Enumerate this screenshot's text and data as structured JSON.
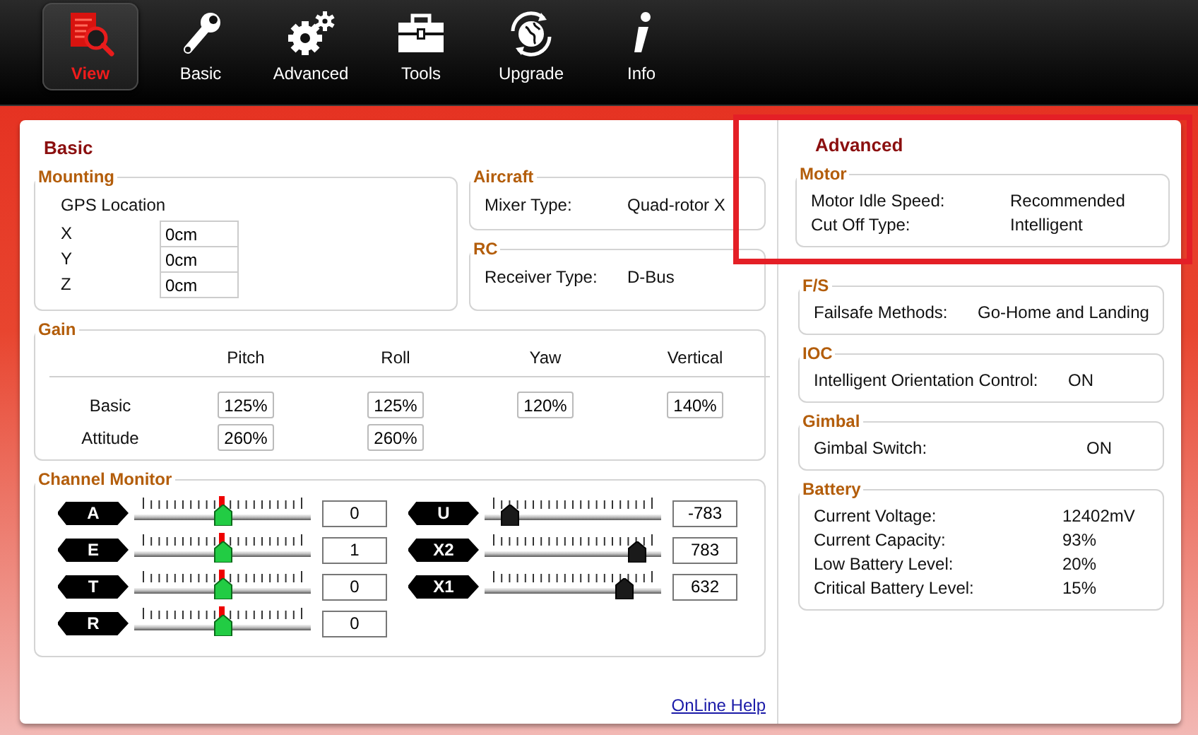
{
  "nav": [
    {
      "label": "View",
      "kind": "view",
      "selected": true
    },
    {
      "label": "Basic",
      "kind": "wrench",
      "selected": false
    },
    {
      "label": "Advanced",
      "kind": "gears",
      "selected": false
    },
    {
      "label": "Tools",
      "kind": "toolbox",
      "selected": false
    },
    {
      "label": "Upgrade",
      "kind": "globe",
      "selected": false
    },
    {
      "label": "Info",
      "kind": "info",
      "selected": false
    }
  ],
  "basic": {
    "title": "Basic",
    "mounting": {
      "legend": "Mounting",
      "subtitle": "GPS Location",
      "axes": [
        {
          "label": "X",
          "value": "0cm"
        },
        {
          "label": "Y",
          "value": "0cm"
        },
        {
          "label": "Z",
          "value": "0cm"
        }
      ]
    },
    "aircraft": {
      "legend": "Aircraft",
      "rows": [
        {
          "label": "Mixer Type:",
          "value": "Quad-rotor X"
        }
      ]
    },
    "rc": {
      "legend": "RC",
      "rows": [
        {
          "label": "Receiver Type:",
          "value": "D-Bus"
        }
      ]
    },
    "gain": {
      "legend": "Gain",
      "columns": [
        "Pitch",
        "Roll",
        "Yaw",
        "Vertical"
      ],
      "rows": [
        {
          "label": "Basic",
          "values": [
            "125%",
            "125%",
            "120%",
            "140%"
          ]
        },
        {
          "label": "Attitude",
          "values": [
            "260%",
            "260%"
          ]
        }
      ]
    },
    "channel_monitor": {
      "legend": "Channel Monitor",
      "channels": [
        {
          "name": "A",
          "kind": "stick",
          "level": 0.5,
          "value": "0"
        },
        {
          "name": "E",
          "kind": "stick",
          "level": 0.5,
          "value": "1"
        },
        {
          "name": "T",
          "kind": "stick",
          "level": 0.5,
          "value": "0"
        },
        {
          "name": "R",
          "kind": "stick",
          "level": 0.5,
          "value": "0"
        },
        {
          "name": "U",
          "kind": "switch",
          "level": 0.14,
          "value": "-783"
        },
        {
          "name": "X2",
          "kind": "switch",
          "level": 0.86,
          "value": "783"
        },
        {
          "name": "X1",
          "kind": "switch",
          "level": 0.79,
          "value": "632"
        }
      ]
    },
    "help_link": "OnLine Help"
  },
  "advanced": {
    "title": "Advanced",
    "highlighted": true,
    "groups": [
      {
        "legend": "Motor",
        "rows": [
          {
            "label": "Motor Idle Speed:",
            "value": "Recommended"
          },
          {
            "label": "Cut Off Type:",
            "value": "Intelligent"
          }
        ]
      },
      {
        "legend": "F/S",
        "rows": [
          {
            "label": "Failsafe Methods:",
            "value": "Go-Home and Landing"
          }
        ]
      },
      {
        "legend": "IOC",
        "rows": [
          {
            "label": "Intelligent Orientation Control:",
            "value": "ON"
          }
        ]
      },
      {
        "legend": "Gimbal",
        "rows": [
          {
            "label": "Gimbal Switch:",
            "value": "ON"
          }
        ]
      },
      {
        "legend": "Battery",
        "rows": [
          {
            "label": "Current Voltage:",
            "value": "12402mV"
          },
          {
            "label": "Current Capacity:",
            "value": "93%"
          },
          {
            "label": "Low Battery Level:",
            "value": "20%"
          },
          {
            "label": "Critical Battery Level:",
            "value": "15%"
          }
        ]
      }
    ]
  }
}
